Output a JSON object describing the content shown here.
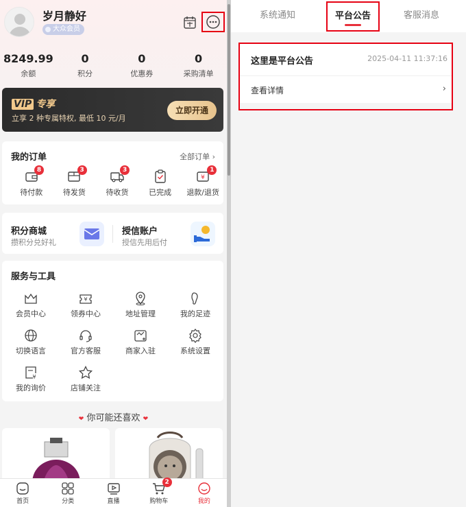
{
  "profile": {
    "username": "岁月静好",
    "member_level": "大众会员",
    "stats": [
      {
        "value": "8249.99",
        "label": "余额"
      },
      {
        "value": "0",
        "label": "积分"
      },
      {
        "value": "0",
        "label": "优惠券"
      },
      {
        "value": "0",
        "label": "采购清单"
      }
    ]
  },
  "vip": {
    "title": "专享",
    "title_prefix": "VIP",
    "desc": "立享 2 种专属特权, 最低 10 元/月",
    "button": "立即开通"
  },
  "orders": {
    "title": "我的订单",
    "all_link": "全部订单",
    "items": [
      {
        "label": "待付款",
        "badge": "8",
        "icon": "wallet-icon"
      },
      {
        "label": "待发货",
        "badge": "3",
        "icon": "package-icon"
      },
      {
        "label": "待收货",
        "badge": "3",
        "icon": "truck-icon"
      },
      {
        "label": "已完成",
        "badge": "",
        "icon": "clipboard-check-icon"
      },
      {
        "label": "退款/退货",
        "badge": "1",
        "icon": "refund-icon"
      }
    ]
  },
  "mall": {
    "points_title": "积分商城",
    "points_sub": "攒积分兑好礼",
    "credit_title": "授信账户",
    "credit_sub": "授信先用后付"
  },
  "tools": {
    "title": "服务与工具",
    "items": [
      {
        "label": "会员中心",
        "icon": "crown-icon"
      },
      {
        "label": "领券中心",
        "icon": "coupon-icon"
      },
      {
        "label": "地址管理",
        "icon": "location-icon"
      },
      {
        "label": "我的足迹",
        "icon": "footprint-icon"
      },
      {
        "label": "切换语言",
        "icon": "globe-icon"
      },
      {
        "label": "官方客服",
        "icon": "headset-icon"
      },
      {
        "label": "商家入驻",
        "icon": "store-icon"
      },
      {
        "label": "系统设置",
        "icon": "gear-icon"
      },
      {
        "label": "我的询价",
        "icon": "inquiry-icon"
      },
      {
        "label": "店铺关注",
        "icon": "star-icon"
      }
    ]
  },
  "guess": {
    "label": "你可能还喜欢"
  },
  "tabbar": [
    {
      "label": "首页",
      "icon": "home-icon"
    },
    {
      "label": "分类",
      "icon": "category-icon"
    },
    {
      "label": "直播",
      "icon": "live-icon"
    },
    {
      "label": "购物车",
      "icon": "cart-icon",
      "badge": "2"
    },
    {
      "label": "我的",
      "icon": "profile-icon"
    }
  ],
  "messages": {
    "tabs": [
      "系统通知",
      "平台公告",
      "客服消息"
    ],
    "active_tab": "平台公告",
    "notice": {
      "title": "这里是平台公告",
      "time": "2025-04-11 11:37:16",
      "detail": "查看详情"
    }
  },
  "colors": {
    "accent": "#e8303a",
    "highlight_box": "#e60012",
    "vip_gold": "#f2c98c"
  }
}
